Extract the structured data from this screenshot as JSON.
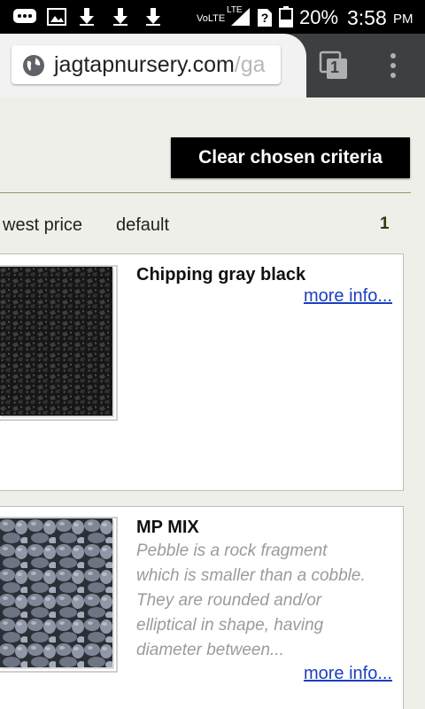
{
  "status_bar": {
    "network": "VoLTE",
    "signal_label": "LTE",
    "battery": "20%",
    "time": "3:58",
    "ampm": "PM"
  },
  "browser": {
    "url_domain": "jagtapnursery.com",
    "url_path": "/ga",
    "tab_count": "1"
  },
  "page": {
    "clear_button": "Clear chosen criteria",
    "sort_options": [
      "west price",
      "default"
    ],
    "page_number": "1"
  },
  "products": [
    {
      "title": "Chipping gray black",
      "description": "",
      "more_link": "more info..."
    },
    {
      "title": "MP MIX",
      "description_lines": [
        "Pebble is a rock fragment",
        "which is smaller than a cobble.",
        "They are rounded and/or",
        "elliptical in shape, having",
        "diameter between..."
      ],
      "more_link": "more info..."
    }
  ]
}
